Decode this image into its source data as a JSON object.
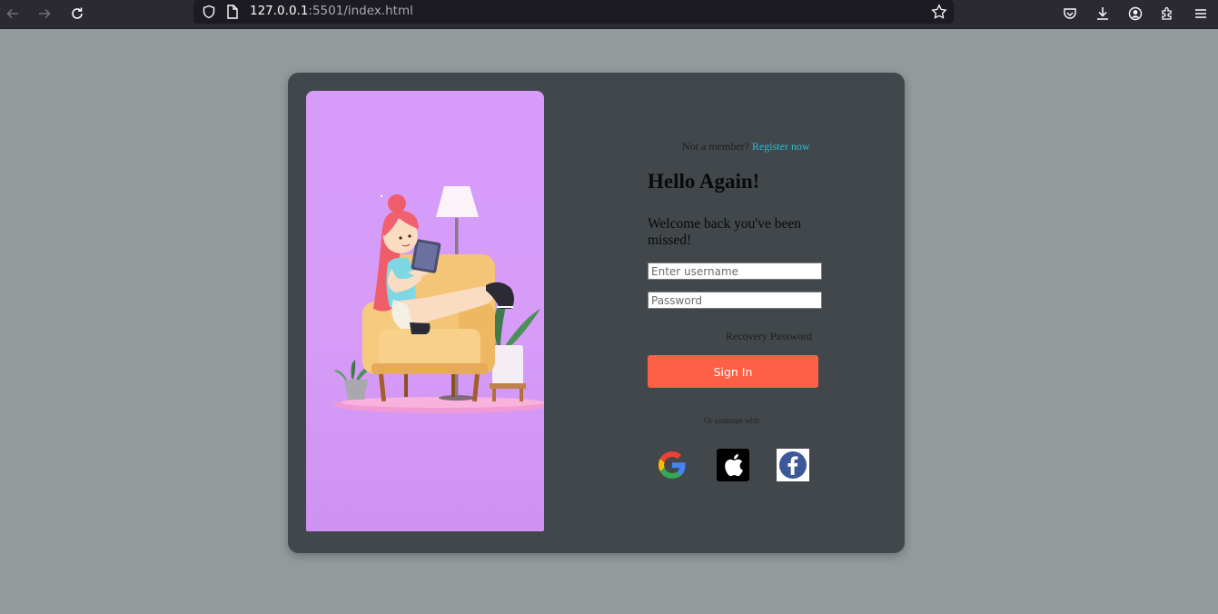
{
  "browser": {
    "url_host": "127.0.0.1",
    "url_rest": ":5501/index.html"
  },
  "register": {
    "prompt": "Not a member?",
    "link": "Register now"
  },
  "heading": "Hello Again!",
  "subheading": "Welcome back you've been missed!",
  "username": {
    "placeholder": "Enter username",
    "value": ""
  },
  "password": {
    "placeholder": "Password",
    "value": ""
  },
  "recovery": "Recovery Password",
  "signin_label": "Sign In",
  "continue_text": "Or continue with",
  "social": [
    "google-icon",
    "apple-icon",
    "facebook-icon"
  ],
  "colors": {
    "page_bg": "#939a9b",
    "card_bg": "#41474a",
    "hero_bg": "#d79bfa",
    "accent": "#fd6045",
    "link": "#27c0d8"
  }
}
